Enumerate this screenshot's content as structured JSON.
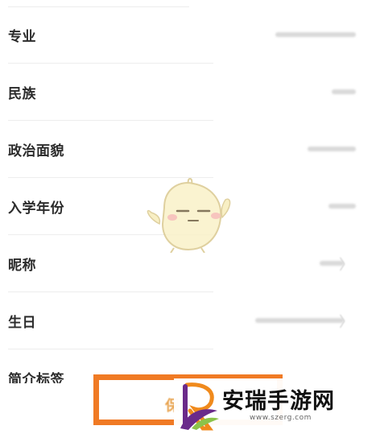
{
  "rows": [
    {
      "label": "专业",
      "value": "",
      "arrow": false
    },
    {
      "label": "民族",
      "value": "",
      "arrow": false
    },
    {
      "label": "政治面貌",
      "value": "",
      "arrow": false
    },
    {
      "label": "入学年份",
      "value": "",
      "arrow": false
    },
    {
      "label": "昵称",
      "value": "",
      "arrow": true
    },
    {
      "label": "生日",
      "value": "",
      "arrow": true
    },
    {
      "label": "简介标签",
      "value": "",
      "arrow": false
    }
  ],
  "bottom": {
    "save_text": "保"
  },
  "watermark": {
    "title": "安瑞手游网",
    "url": "www.szerg.com"
  },
  "icons": {
    "chevron": "chevron-right-icon",
    "mascot": "chick-mascot-icon",
    "logo": "r-leaf-logo-icon"
  },
  "colors": {
    "highlight": "#f07a24",
    "logo_orange": "#f08a1c",
    "logo_purple": "#6a2a8a",
    "logo_green": "#8bc34a"
  }
}
